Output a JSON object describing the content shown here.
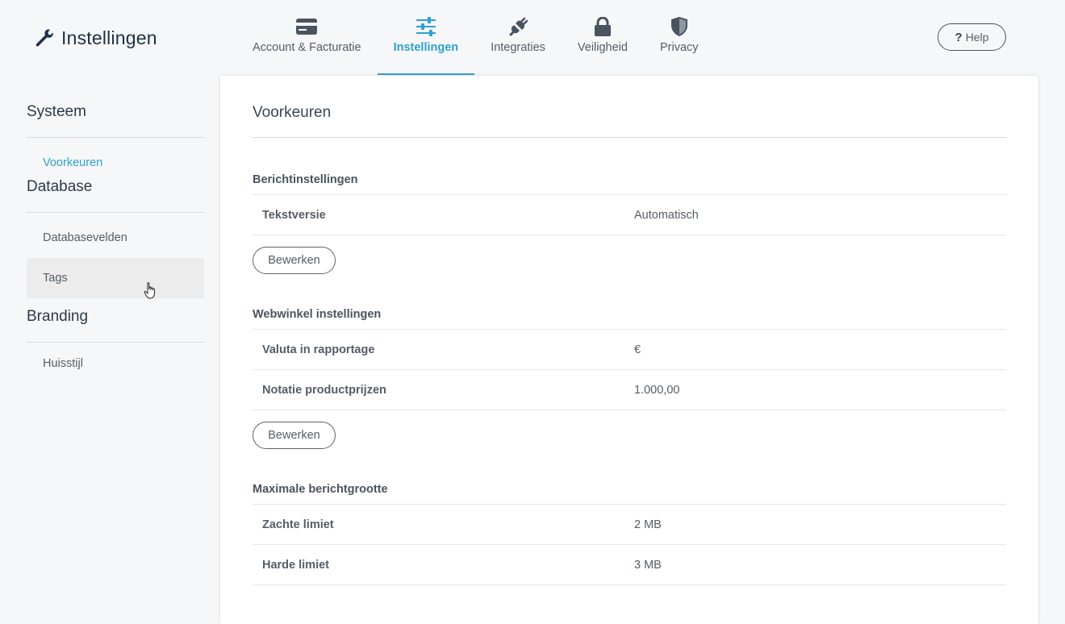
{
  "header": {
    "app_title": "Instellingen",
    "app_icon": "wrench-icon",
    "tabs": [
      {
        "label": "Account & Facturatie",
        "icon": "credit-card-icon",
        "active": false
      },
      {
        "label": "Instellingen",
        "icon": "sliders-icon",
        "active": true
      },
      {
        "label": "Integraties",
        "icon": "plug-icon",
        "active": false
      },
      {
        "label": "Veiligheid",
        "icon": "lock-icon",
        "active": false
      },
      {
        "label": "Privacy",
        "icon": "shield-icon",
        "active": false
      }
    ],
    "help_label": "Help",
    "help_symbol": "?"
  },
  "sidebar": {
    "groups": [
      {
        "heading": "Systeem",
        "items": [
          {
            "label": "Voorkeuren",
            "active": true
          }
        ]
      },
      {
        "heading": "Database",
        "items": [
          {
            "label": "Databasevelden"
          },
          {
            "label": "Tags",
            "hover": true
          }
        ]
      },
      {
        "heading": "Branding",
        "items": [
          {
            "label": "Huisstijl"
          }
        ]
      }
    ]
  },
  "main": {
    "title": "Voorkeuren",
    "sections": [
      {
        "title": "Berichtinstellingen",
        "rows": [
          {
            "key": "Tekstversie",
            "value": "Automatisch"
          }
        ],
        "button": "Bewerken"
      },
      {
        "title": "Webwinkel instellingen",
        "rows": [
          {
            "key": "Valuta in rapportage",
            "value": "€"
          },
          {
            "key": "Notatie productprijzen",
            "value": "1.000,00"
          }
        ],
        "button": "Bewerken"
      },
      {
        "title": "Maximale berichtgrootte",
        "rows": [
          {
            "key": "Zachte limiet",
            "value": "2 MB"
          },
          {
            "key": "Harde limiet",
            "value": "3 MB"
          }
        ]
      }
    ]
  },
  "colors": {
    "accent": "#2ea0d3",
    "title_dark": "#1d3146",
    "text": "#555d66",
    "background": "#f6f7f8",
    "panel": "#ffffff"
  }
}
